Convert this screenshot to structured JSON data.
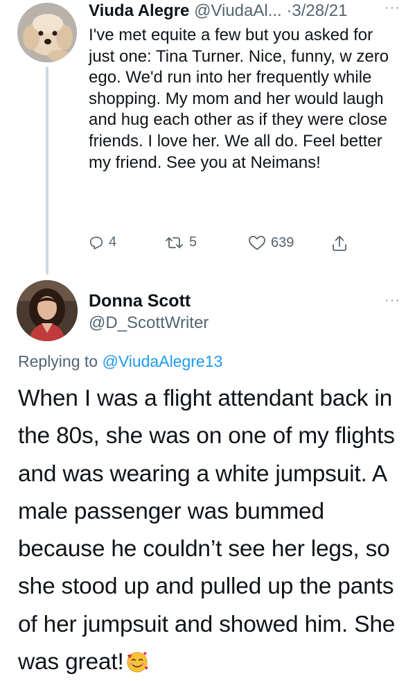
{
  "tweet1": {
    "display_name": "Viuda Alegre",
    "handle": "@ViudaAl...",
    "date": "3/28/21",
    "more": "···",
    "text": "I've met equite a few but you asked for just one: Tina Turner. Nice, funny, w zero ego. We'd run into her frequently while shopping. My mom and her would laugh and hug each other as if they were close friends.  I love her. We all do. Feel better my friend. See you at Neimans!",
    "replies": "4",
    "retweets": "5",
    "likes": "639",
    "icons": [
      "reply-icon",
      "retweet-icon",
      "like-icon",
      "share-icon"
    ]
  },
  "tweet2": {
    "display_name": "Donna Scott",
    "handle": "@D_ScottWriter",
    "more": "···",
    "replying_prefix": "Replying to ",
    "replying_to": "@ViudaAlegre13",
    "text": "When I was a flight attendant back in the 80s, she was on one of my flights and was wearing a white jumpsuit. A male passenger was bummed because he couldn’t see her legs, so she stood up and pulled up the pants of her jumpsuit and showed him. She was great!",
    "emoji": "smiling-face-with-hearts"
  },
  "colors": {
    "text": "#0f1419",
    "secondary": "#536471",
    "link": "#1d9bf0",
    "thread_line": "#cfd9de"
  }
}
